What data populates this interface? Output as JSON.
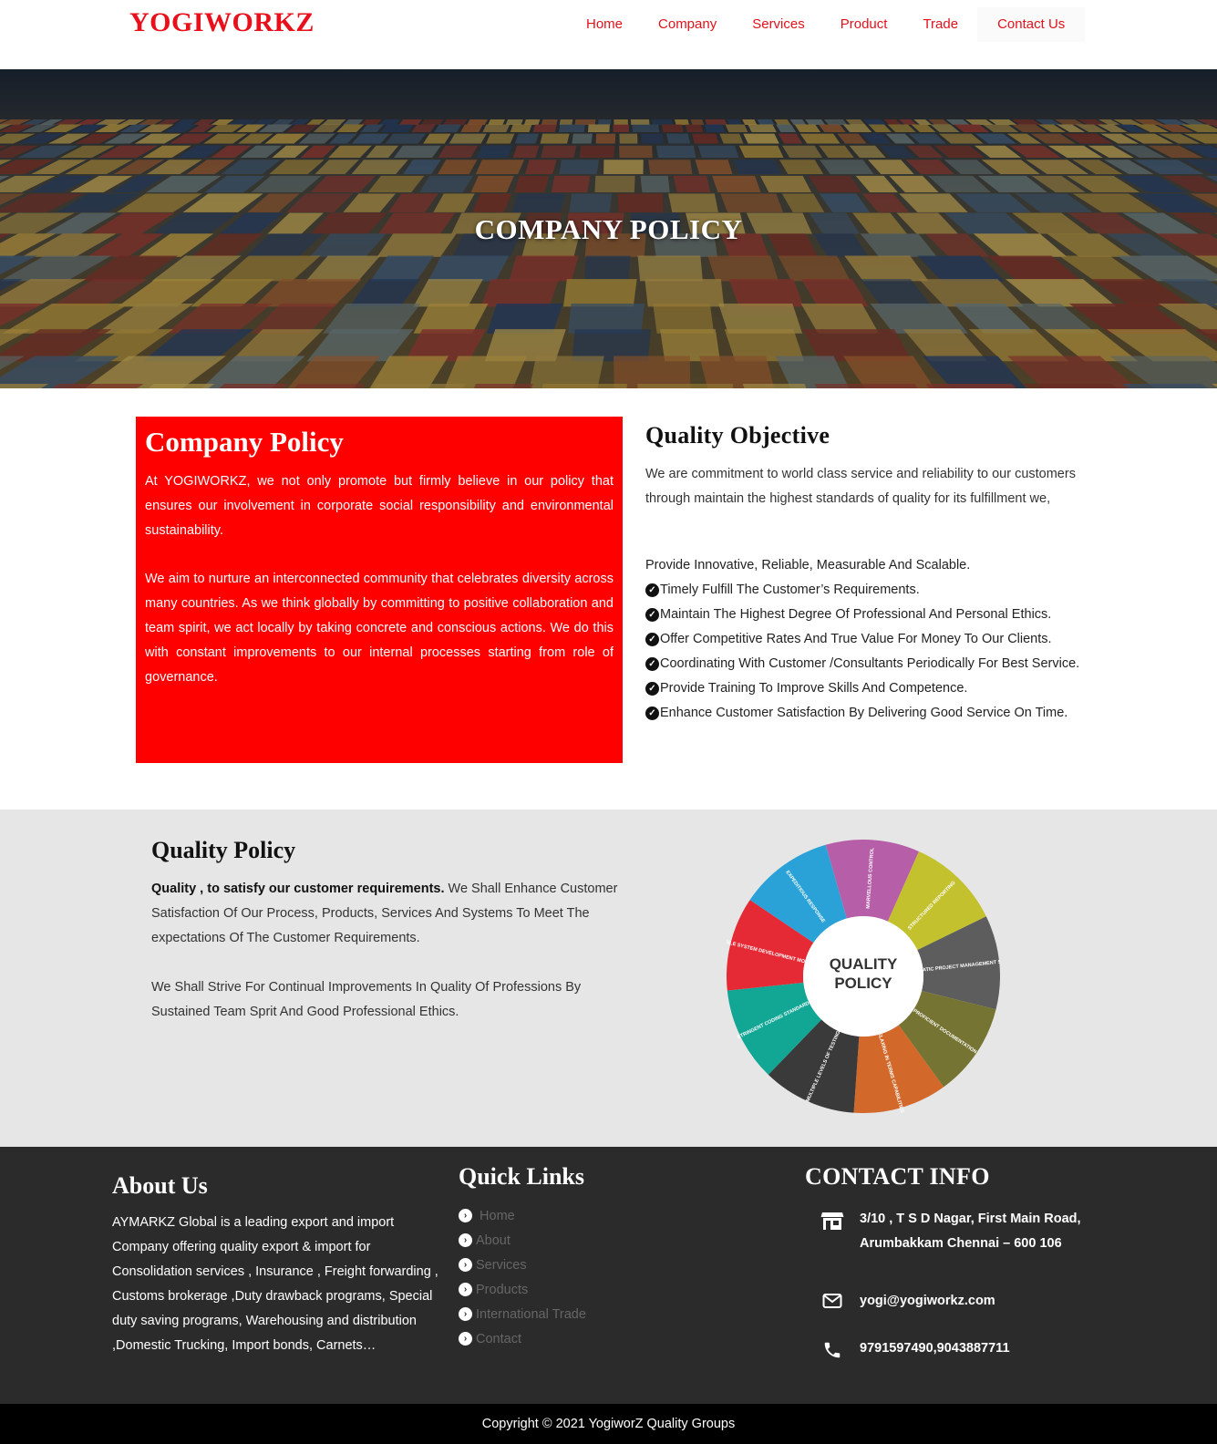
{
  "header": {
    "logo": "YOGIWORKZ",
    "nav": [
      "Home",
      "Company",
      "Services",
      "Product",
      "Trade",
      "Contact Us"
    ]
  },
  "hero": {
    "title": "COMPANY POLICY"
  },
  "company_policy": {
    "title": "Company Policy",
    "para1": "At YOGIWORKZ, we not only promote but firmly believe in our policy that ensures our involvement in corporate social responsibility and environmental sustainability.",
    "para2": "We aim to nurture an interconnected community that celebrates diversity across many countries. As we think globally by committing to positive collaboration and team spirit, we act locally by taking concrete and conscious actions. We do this with constant improvements to our internal processes starting from role of governance."
  },
  "quality_objective": {
    "title": "Quality Objective",
    "intro": "We are commitment to world class service and reliability to our customers through maintain the highest standards of quality for its fulfillment we,",
    "first_item": "Provide Innovative, Reliable, Measurable And Scalable.",
    "items": [
      "Timely Fulfill The Customer’s Requirements.",
      "Maintain The Highest Degree Of Professional And Personal Ethics.",
      "Offer Competitive Rates And True Value For Money To Our Clients.",
      "Coordinating With Customer /Consultants Periodically For Best Service.",
      "Provide Training To Improve Skills And Competence.",
      "Enhance Customer Satisfaction By Delivering Good Service On Time."
    ]
  },
  "quality_policy": {
    "title": "Quality Policy",
    "bold_lead": "Quality , to satisfy our customer requirements.",
    "para1_rest": " We Shall Enhance Customer Satisfaction Of Our Process, Products, Services And Systems To Meet The expectations Of The Customer Requirements.",
    "para2": "We Shall Strive For Continual Improvements In Quality Of Professions By Sustained Team Sprit And Good Professional Ethics.",
    "wheel": {
      "center_line1": "QUALITY",
      "center_line2": "POLICY",
      "segments": [
        {
          "label": "MARVELLOUS CONTROL",
          "color": "#b65fa8"
        },
        {
          "label": "STRUCTURED REPORTING",
          "color": "#c4c12e"
        },
        {
          "label": "PRAGMATIC PROJECT MANAGEMENT SYSTEM",
          "color": "#5d5d5d"
        },
        {
          "label": "PROFICIENT DOCUMENTATION",
          "color": "#767433"
        },
        {
          "label": "RELAXING IN TERMS CAPABILITIES",
          "color": "#d2692b"
        },
        {
          "label": "MULTIPLE LEVELS OF TESTING",
          "color": "#3a3a3a"
        },
        {
          "label": "STRINGENT CODING STANDARDS",
          "color": "#12a695"
        },
        {
          "label": "AGILE SYSTEM DEVELOPMENT MODEL",
          "color": "#e52a36"
        },
        {
          "label": "EXPEDITIOUS RESPONSE",
          "color": "#2aa2d8"
        }
      ]
    }
  },
  "footer": {
    "about_title": "About Us",
    "about_text": "AYMARKZ Global is a leading export and import Company offering quality export & import for Consolidation services , Insurance , Freight forwarding , Customs brokerage ,Duty drawback programs, Special duty saving programs, Warehousing and distribution ,Domestic Trucking, Import bonds, Carnets…",
    "links_title": "Quick Links",
    "links": [
      " Home",
      "About",
      "Services",
      "Products",
      "International Trade",
      "Contact"
    ],
    "contact_title": "CONTACT INFO",
    "address_line1": "3/10 , T S D Nagar, First Main Road,",
    "address_line2": "Arumbakkam Chennai – 600 106",
    "email": "yogi@yogiworkz.com",
    "phone": "9791597490,9043887711"
  },
  "copyright": "Copyright © 2021 YogiworZ Quality Groups",
  "colors": {
    "brand_red": "#e8101a",
    "box_red": "#ff0000",
    "footer_bg": "#2b2b2b",
    "section_gray": "#e6e6e6"
  }
}
